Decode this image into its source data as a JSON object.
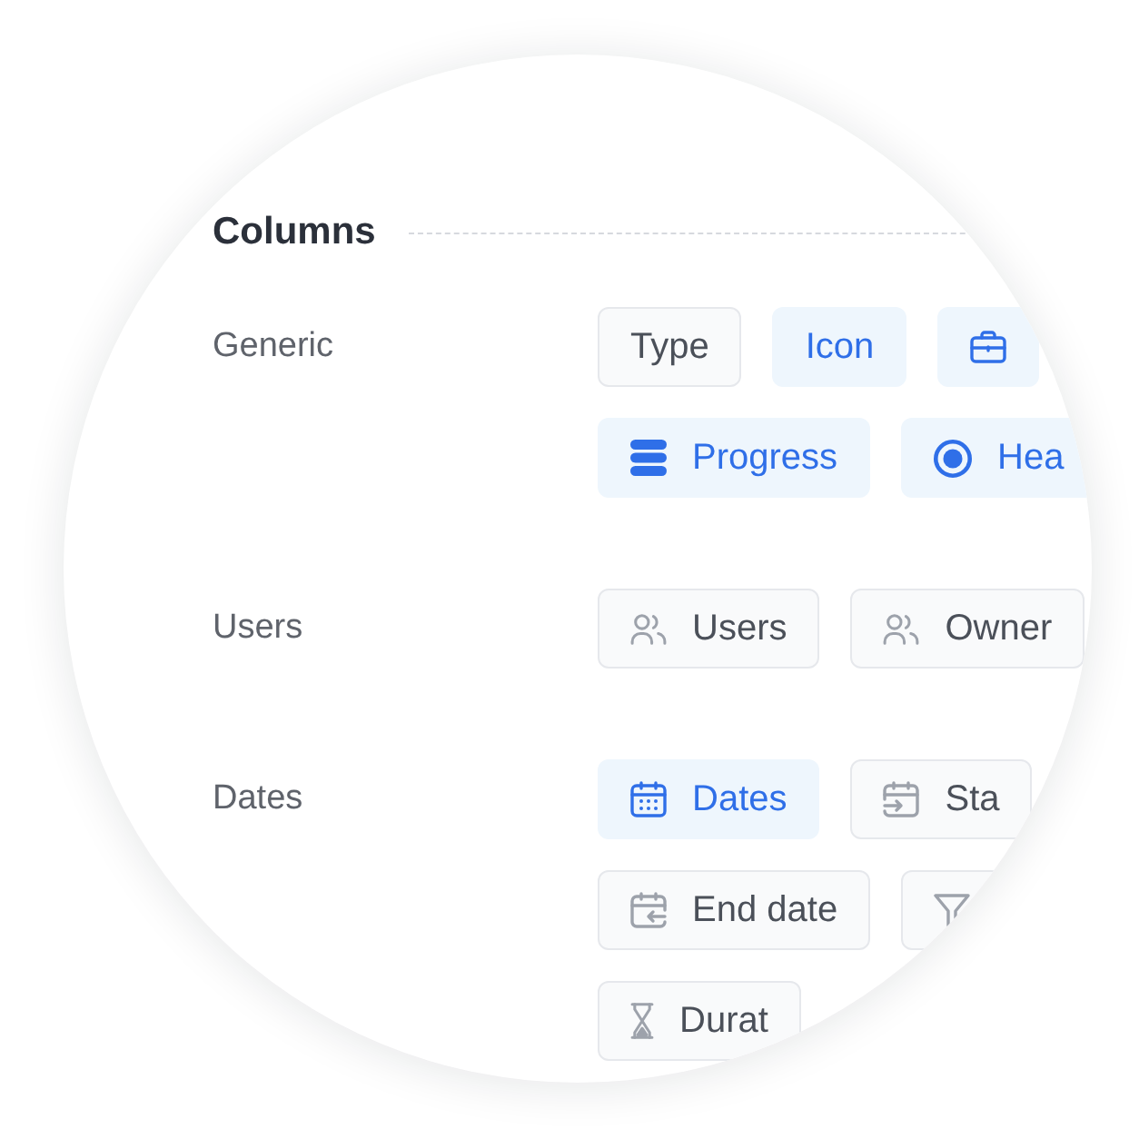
{
  "section": {
    "title": "Columns"
  },
  "groups": [
    {
      "label": "Generic",
      "rows": [
        {
          "options": [
            {
              "label": "Type",
              "selected": false
            },
            {
              "label": "Icon",
              "selected": true
            },
            {
              "selected": true
            }
          ]
        },
        {
          "options": [
            {
              "label": "Progress",
              "selected": true
            },
            {
              "label": "Hea",
              "selected": true
            }
          ]
        }
      ]
    },
    {
      "label": "Users",
      "rows": [
        {
          "options": [
            {
              "label": "Users",
              "selected": false
            },
            {
              "label": "Owner",
              "selected": false
            }
          ]
        }
      ]
    },
    {
      "label": "Dates",
      "rows": [
        {
          "options": [
            {
              "label": "Dates",
              "selected": true
            },
            {
              "label": "Sta",
              "selected": false
            }
          ]
        },
        {
          "options": [
            {
              "label": "End date",
              "selected": false
            },
            {
              "selected": false
            }
          ]
        },
        {
          "options": [
            {
              "label": "Durat",
              "selected": false
            }
          ]
        }
      ]
    }
  ]
}
